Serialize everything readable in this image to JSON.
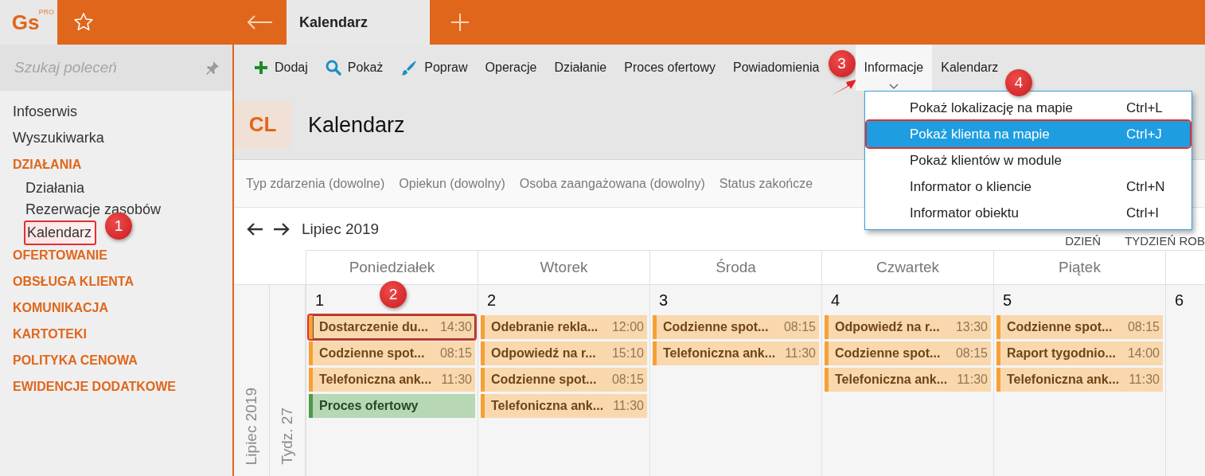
{
  "app": {
    "logo": "Gs",
    "logo_badge": "PRO"
  },
  "tabs": [
    {
      "label": "Kalendarz",
      "selected": true
    }
  ],
  "sidebar": {
    "search": {
      "placeholder": "Szukaj poleceń"
    },
    "items": [
      {
        "label": "Infoserwis",
        "kind": "link"
      },
      {
        "label": "Wyszukiwarka",
        "kind": "link"
      },
      {
        "label": "DZIAŁANIA",
        "kind": "section",
        "children": [
          {
            "label": "Działania",
            "annotated": false
          },
          {
            "label": "Rezerwacje zasobów",
            "annotated": false
          },
          {
            "label": "Kalendarz",
            "annotated": true
          }
        ]
      },
      {
        "label": "OFERTOWANIE",
        "kind": "section"
      },
      {
        "label": "OBSŁUGA KLIENTA",
        "kind": "section"
      },
      {
        "label": "KOMUNIKACJA",
        "kind": "section"
      },
      {
        "label": "KARTOTEKI",
        "kind": "section"
      },
      {
        "label": "POLITYKA CENOWA",
        "kind": "section"
      },
      {
        "label": "EWIDENCJE DODATKOWE",
        "kind": "section"
      }
    ]
  },
  "toolbar": [
    {
      "label": "Dodaj",
      "open": false
    },
    {
      "label": "Pokaż",
      "open": false
    },
    {
      "label": "Popraw",
      "open": false
    },
    {
      "label": "Operacje",
      "open": false
    },
    {
      "label": "Działanie",
      "open": false
    },
    {
      "label": "Proces ofertowy",
      "open": false
    },
    {
      "label": "Powiadomienia",
      "open": false
    },
    {
      "label": "Informacje",
      "open": true
    },
    {
      "label": "Kalendarz",
      "open": false
    }
  ],
  "module": {
    "badge": "CL",
    "title": "Kalendarz"
  },
  "filters": [
    "Typ zdarzenia (dowolne)",
    "Opiekun (dowolny)",
    "Osoba zaangażowana (dowolny)",
    "Status zakończe"
  ],
  "calendar": {
    "period": "Lipiec 2019",
    "views": [
      "DZIEŃ",
      "TYDZIEŃ ROB"
    ],
    "month_label": "Lipiec 2019",
    "week_label": "Tydz. 27",
    "days": [
      {
        "name": "Poniedziałek",
        "date": "1",
        "events": [
          {
            "title": "Dostarczenie du...",
            "time": "14:30",
            "kind": "task",
            "selected": true
          },
          {
            "title": "Codzienne spot...",
            "time": "08:15",
            "kind": "task",
            "selected": false
          },
          {
            "title": "Telefoniczna ank...",
            "time": "11:30",
            "kind": "task",
            "selected": false
          },
          {
            "title": "Proces ofertowy",
            "kind": "process",
            "selected": false
          }
        ]
      },
      {
        "name": "Wtorek",
        "date": "2",
        "events": [
          {
            "title": "Odebranie rekla...",
            "time": "12:00",
            "kind": "task",
            "selected": false
          },
          {
            "title": "Odpowiedź na r...",
            "time": "15:10",
            "kind": "task",
            "selected": false
          },
          {
            "title": "Codzienne spot...",
            "time": "08:15",
            "kind": "task",
            "selected": false
          },
          {
            "title": "Telefoniczna ank...",
            "time": "11:30",
            "kind": "task",
            "selected": false
          }
        ]
      },
      {
        "name": "Środa",
        "date": "3",
        "events": [
          {
            "title": "Codzienne spot...",
            "time": "08:15",
            "kind": "task",
            "selected": false
          },
          {
            "title": "Telefoniczna ank...",
            "time": "11:30",
            "kind": "task",
            "selected": false
          }
        ]
      },
      {
        "name": "Czwartek",
        "date": "4",
        "events": [
          {
            "title": "Odpowiedź na r...",
            "time": "13:30",
            "kind": "task",
            "selected": false
          },
          {
            "title": "Codzienne spot...",
            "time": "08:15",
            "kind": "task",
            "selected": false
          },
          {
            "title": "Telefoniczna ank...",
            "time": "11:30",
            "kind": "task",
            "selected": false
          }
        ]
      },
      {
        "name": "Piątek",
        "date": "5",
        "events": [
          {
            "title": "Codzienne spot...",
            "time": "08:15",
            "kind": "task",
            "selected": false
          },
          {
            "title": "Raport tygodnio...",
            "time": "14:00",
            "kind": "task",
            "selected": false
          },
          {
            "title": "Telefoniczna ank...",
            "time": "11:30",
            "kind": "task",
            "selected": false
          }
        ]
      },
      {
        "date": "6"
      }
    ]
  },
  "menu": {
    "items": [
      {
        "label": "Pokaż lokalizację na mapie",
        "shortcut": "Ctrl+L",
        "selected": false,
        "annotated": false
      },
      {
        "label": "Pokaż klienta na mapie",
        "shortcut": "Ctrl+J",
        "selected": true,
        "annotated": true
      },
      {
        "label": "Pokaż klientów w module",
        "selected": false,
        "annotated": false
      },
      {
        "label": "Informator o kliencie",
        "shortcut": "Ctrl+N",
        "selected": false,
        "annotated": false
      },
      {
        "label": "Informator obiektu",
        "shortcut": "Ctrl+I",
        "selected": false,
        "annotated": false
      }
    ]
  },
  "callouts": [
    "1",
    "2",
    "3",
    "4"
  ]
}
